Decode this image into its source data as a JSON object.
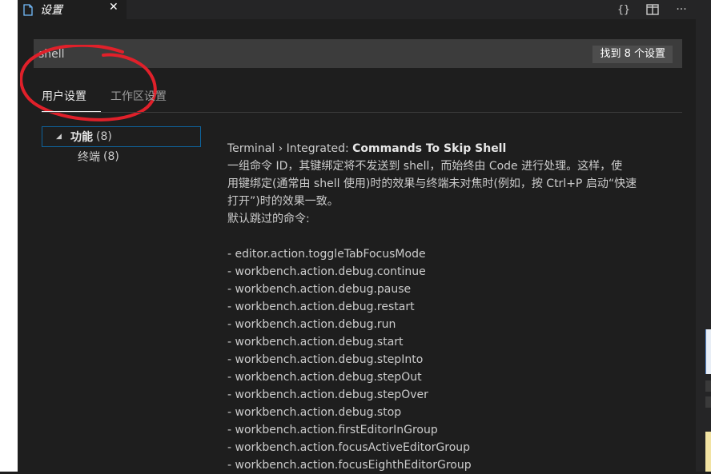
{
  "tab": {
    "title": "设置",
    "close_glyph": "✕",
    "icon": "file-icon"
  },
  "actions": {
    "json_label": "{}",
    "split_icon": "split-editor-icon",
    "more_label": "···"
  },
  "search": {
    "value": "shell",
    "result_badge": "找到 8 个设置"
  },
  "scope_tabs": {
    "user": "用户设置",
    "workspace": "工作区设置"
  },
  "toc": {
    "feature": {
      "caret": "◢",
      "label": "功能",
      "count": "(8)"
    },
    "terminal": {
      "label": "终端",
      "count": "(8)"
    }
  },
  "setting": {
    "category": "Terminal › Integrated: ",
    "name": "Commands To Skip Shell",
    "description_lines": [
      "一组命令 ID，其键绑定将不发送到 shell，而始终由 Code 进行处理。这样，使",
      "用键绑定(通常由 shell 使用)时的效果与终端未对焦时(例如，按 Ctrl+P 启动“快速",
      "打开”)时的效果一致。",
      "默认跳过的命令:"
    ],
    "commands": [
      "- editor.action.toggleTabFocusMode",
      "- workbench.action.debug.continue",
      "- workbench.action.debug.pause",
      "- workbench.action.debug.restart",
      "- workbench.action.debug.run",
      "- workbench.action.debug.start",
      "- workbench.action.debug.stepInto",
      "- workbench.action.debug.stepOut",
      "- workbench.action.debug.stepOver",
      "- workbench.action.debug.stop",
      "- workbench.action.firstEditorInGroup",
      "- workbench.action.focusActiveEditorGroup",
      "- workbench.action.focusEighthEditorGroup"
    ]
  },
  "colors": {
    "background": "#1e1e1e",
    "input_bg": "#3c3c3c",
    "focus_border": "#0e639c",
    "annotation": "#e0202a"
  }
}
